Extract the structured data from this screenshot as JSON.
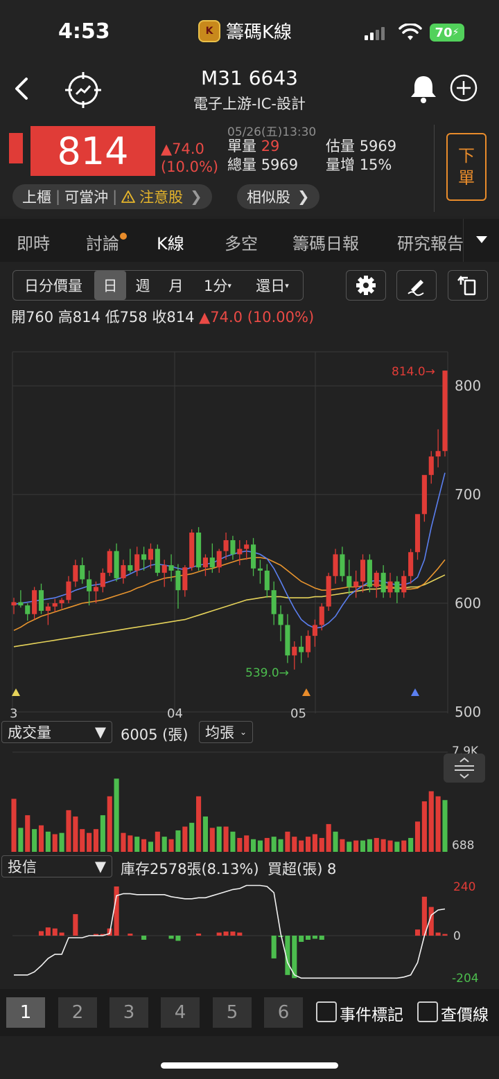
{
  "status": {
    "time": "4:53",
    "app_name": "籌碼K線",
    "battery": "70"
  },
  "header": {
    "title": "M31 6643",
    "subtitle": "電子上游-IC-設計"
  },
  "quote": {
    "price": "814",
    "change": "▲74.0",
    "change_pct": "(10.0%)",
    "date": "05/26(五)13:30",
    "unit_vol_label": "單量",
    "unit_vol": "29",
    "total_vol_label": "總量",
    "total_vol": "5969",
    "est_vol_label": "估量",
    "est_vol": "5969",
    "vol_inc_label": "量增",
    "vol_inc": "15%",
    "order_label_1": "下",
    "order_label_2": "單"
  },
  "tags": {
    "market": "上櫃",
    "daytrade": "可當沖",
    "attention": "注意股",
    "similar": "相似股"
  },
  "tabs": [
    "即時",
    "討論",
    "K線",
    "多空",
    "籌碼日報",
    "研究報告"
  ],
  "toolbar": {
    "intraday": "日分價量",
    "day": "日",
    "week": "週",
    "month": "月",
    "minute": "1分",
    "restore": "還日"
  },
  "ohlc": {
    "open_label": "開",
    "open": "760",
    "high_label": "高",
    "high": "814",
    "low_label": "低",
    "low": "758",
    "close_label": "收",
    "close": "814",
    "change": "▲74.0 (10.00%)"
  },
  "chart_data": [
    {
      "type": "candlestick",
      "y_ticks": [
        "800",
        "700",
        "600",
        "500"
      ],
      "ylim": [
        500,
        830
      ],
      "x_ticks": [
        "3",
        "04",
        "05"
      ],
      "high_mark": "814.0",
      "low_mark": "539.0",
      "candles": [
        [
          598,
          605,
          590,
          601
        ],
        [
          601,
          612,
          596,
          598
        ],
        [
          598,
          600,
          584,
          590
        ],
        [
          590,
          615,
          585,
          612
        ],
        [
          612,
          618,
          590,
          593
        ],
        [
          593,
          600,
          580,
          597
        ],
        [
          597,
          604,
          592,
          600
        ],
        [
          600,
          605,
          595,
          603
        ],
        [
          603,
          625,
          600,
          620
        ],
        [
          620,
          640,
          615,
          635
        ],
        [
          635,
          642,
          618,
          622
        ],
        [
          622,
          630,
          598,
          611
        ],
        [
          611,
          620,
          600,
          615
        ],
        [
          615,
          632,
          610,
          628
        ],
        [
          628,
          650,
          625,
          648
        ],
        [
          648,
          655,
          620,
          623
        ],
        [
          623,
          640,
          618,
          635
        ],
        [
          635,
          650,
          628,
          630
        ],
        [
          630,
          652,
          625,
          645
        ],
        [
          645,
          652,
          630,
          640
        ],
        [
          640,
          655,
          632,
          650
        ],
        [
          650,
          654,
          625,
          628
        ],
        [
          628,
          640,
          615,
          635
        ],
        [
          635,
          645,
          620,
          630
        ],
        [
          630,
          636,
          595,
          612
        ],
        [
          612,
          635,
          606,
          633
        ],
        [
          633,
          668,
          630,
          665
        ],
        [
          665,
          670,
          630,
          633
        ],
        [
          633,
          645,
          625,
          642
        ],
        [
          642,
          655,
          628,
          633
        ],
        [
          633,
          650,
          628,
          648
        ],
        [
          648,
          665,
          640,
          658
        ],
        [
          658,
          662,
          640,
          645
        ],
        [
          645,
          658,
          635,
          650
        ],
        [
          650,
          658,
          640,
          654
        ],
        [
          654,
          660,
          625,
          632
        ],
        [
          632,
          640,
          618,
          630
        ],
        [
          630,
          636,
          605,
          612
        ],
        [
          612,
          620,
          580,
          590
        ],
        [
          590,
          598,
          565,
          580
        ],
        [
          580,
          590,
          545,
          552
        ],
        [
          552,
          565,
          539,
          560
        ],
        [
          560,
          570,
          545,
          555
        ],
        [
          555,
          575,
          550,
          570
        ],
        [
          570,
          585,
          560,
          580
        ],
        [
          580,
          600,
          575,
          597
        ],
        [
          597,
          628,
          593,
          625
        ],
        [
          625,
          650,
          618,
          645
        ],
        [
          645,
          652,
          620,
          625
        ],
        [
          625,
          640,
          608,
          615
        ],
        [
          615,
          630,
          605,
          620
        ],
        [
          620,
          645,
          610,
          640
        ],
        [
          640,
          645,
          610,
          615
        ],
        [
          615,
          630,
          605,
          628
        ],
        [
          628,
          635,
          605,
          610
        ],
        [
          610,
          628,
          605,
          620
        ],
        [
          620,
          625,
          600,
          610
        ],
        [
          610,
          630,
          605,
          625
        ],
        [
          625,
          650,
          618,
          647
        ],
        [
          647,
          680,
          640,
          682
        ],
        [
          682,
          715,
          675,
          718
        ],
        [
          718,
          740,
          710,
          735
        ],
        [
          735,
          760,
          725,
          740
        ],
        [
          740,
          814,
          735,
          814
        ]
      ],
      "ma_blue": [
        599,
        600,
        601,
        602,
        603,
        604,
        605,
        607,
        609,
        612,
        614,
        616,
        617,
        618,
        620,
        622,
        624,
        627,
        630,
        632,
        635,
        636,
        635,
        634,
        632,
        631,
        633,
        635,
        636,
        637,
        640,
        643,
        645,
        647,
        648,
        647,
        645,
        641,
        632,
        620,
        607,
        595,
        585,
        580,
        577,
        578,
        582,
        588,
        598,
        607,
        612,
        616,
        620,
        621,
        620,
        618,
        617,
        617,
        619,
        624,
        640,
        670,
        695,
        720
      ],
      "ma_orange": [
        575,
        578,
        582,
        585,
        588,
        590,
        592,
        594,
        596,
        598,
        600,
        601,
        602,
        603,
        605,
        607,
        609,
        611,
        614,
        616,
        619,
        621,
        623,
        624,
        625,
        626,
        627,
        629,
        631,
        632,
        634,
        636,
        638,
        640,
        641,
        642,
        642,
        641,
        638,
        635,
        630,
        625,
        620,
        617,
        614,
        612,
        612,
        613,
        614,
        615,
        615,
        616,
        617,
        617,
        616,
        615,
        614,
        613,
        613,
        614,
        618,
        625,
        632,
        640
      ],
      "ma_yellow": [
        560,
        561,
        562,
        563,
        564,
        565,
        566,
        567,
        568,
        569,
        570,
        571,
        572,
        573,
        574,
        575,
        576,
        577,
        578,
        579,
        580,
        581,
        582,
        583,
        584,
        585,
        587,
        589,
        591,
        593,
        595,
        597,
        599,
        601,
        603,
        604,
        605,
        606,
        606,
        606,
        605,
        605,
        605,
        605,
        606,
        606,
        607,
        608,
        609,
        610,
        611,
        612,
        613,
        613,
        614,
        614,
        614,
        614,
        615,
        615,
        617,
        620,
        623,
        626
      ]
    },
    {
      "type": "bar",
      "title": "成交量",
      "value_label": "6005 (張)",
      "avg_label": "均張",
      "y_ticks": [
        "7.9K",
        "688"
      ],
      "values": [
        4200,
        1900,
        2900,
        1800,
        2100,
        1600,
        1400,
        1500,
        3300,
        2800,
        1800,
        1500,
        1800,
        2900,
        4400,
        5800,
        1500,
        1300,
        1200,
        1000,
        800,
        1600,
        1200,
        1000,
        1700,
        2000,
        2300,
        4400,
        2800,
        1900,
        2000,
        2000,
        1600,
        1100,
        1300,
        1000,
        900,
        1100,
        1200,
        1000,
        1600,
        1200,
        900,
        1200,
        1400,
        1100,
        2200,
        1600,
        1000,
        800,
        900,
        900,
        1000,
        1100,
        1000,
        900,
        800,
        900,
        1100,
        2400,
        4000,
        4800,
        4400,
        4100
      ],
      "colors": "rgrgrgrgrrrrrgrgrrgrgrgrgrgrgrgrgrrggrggrrrrrrrgrgrggrrrgrgrrrr"
    },
    {
      "type": "bar+line",
      "title": "投信",
      "inventory_label": "庫存2578張(8.13%)",
      "net_label": "買超(張) 8",
      "y_ticks": [
        "240",
        "0",
        "-204"
      ],
      "bar_values": [
        0,
        0,
        0,
        0,
        22,
        40,
        35,
        15,
        0,
        105,
        0,
        0,
        8,
        8,
        35,
        240,
        0,
        10,
        0,
        -20,
        0,
        0,
        0,
        -15,
        -25,
        0,
        0,
        10,
        0,
        0,
        15,
        20,
        20,
        15,
        0,
        0,
        0,
        0,
        -110,
        -5,
        -190,
        -205,
        -30,
        -20,
        -15,
        -20,
        0,
        0,
        0,
        0,
        0,
        0,
        0,
        0,
        0,
        0,
        0,
        0,
        0,
        30,
        190,
        140,
        15,
        8
      ],
      "line_values": [
        -190,
        -190,
        -190,
        -175,
        -145,
        -110,
        -90,
        -90,
        -10,
        -10,
        -10,
        0,
        0,
        0,
        10,
        195,
        205,
        205,
        200,
        200,
        200,
        200,
        200,
        190,
        185,
        180,
        180,
        185,
        185,
        195,
        205,
        215,
        225,
        230,
        245,
        245,
        245,
        240,
        210,
        10,
        -130,
        -190,
        -205,
        -205,
        -205,
        -205,
        -205,
        -205,
        -205,
        -205,
        -205,
        -205,
        -205,
        -205,
        -205,
        -205,
        -205,
        -200,
        -190,
        -130,
        0,
        100,
        125,
        130
      ]
    }
  ],
  "pages": [
    "1",
    "2",
    "3",
    "4",
    "5",
    "6"
  ],
  "checks": {
    "event_mark": "事件標記",
    "price_line": "查價線"
  },
  "colors": {
    "up": "#e03c37",
    "down": "#4cbd4e",
    "accent": "#e98c2b"
  }
}
